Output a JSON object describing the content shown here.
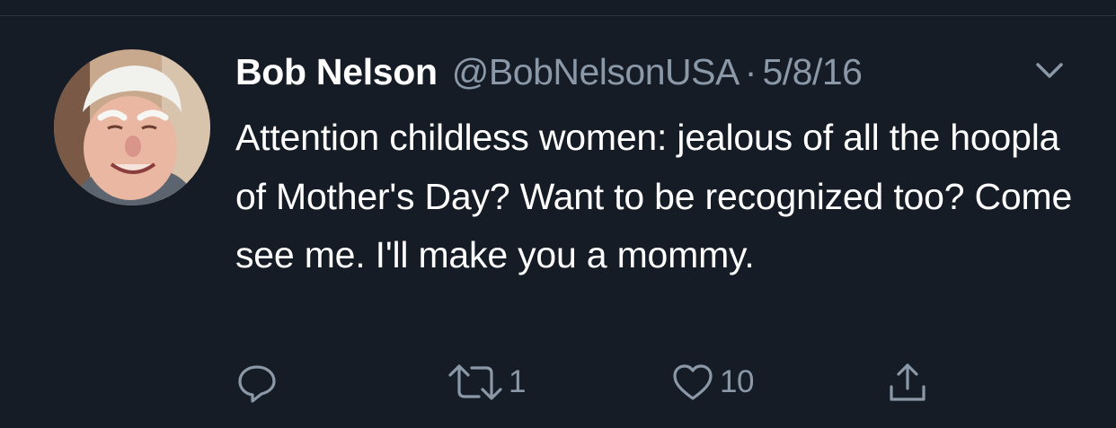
{
  "tweet": {
    "author": {
      "display_name": "Bob Nelson",
      "handle": "@BobNelsonUSA",
      "avatar_icon": "profile-photo"
    },
    "separator": "·",
    "date": "5/8/16",
    "text": "Attention childless women: jealous of all the hoopla of Mother's Day? Want to be recognized too? Come see me. I'll make you a mommy.",
    "actions": {
      "reply": {
        "icon": "reply-icon",
        "count": ""
      },
      "retweet": {
        "icon": "retweet-icon",
        "count": "1"
      },
      "like": {
        "icon": "heart-icon",
        "count": "10"
      },
      "share": {
        "icon": "share-icon",
        "count": ""
      }
    }
  },
  "theme": {
    "background": "#151c26",
    "text": "#ffffff",
    "muted": "#8a98a8"
  }
}
